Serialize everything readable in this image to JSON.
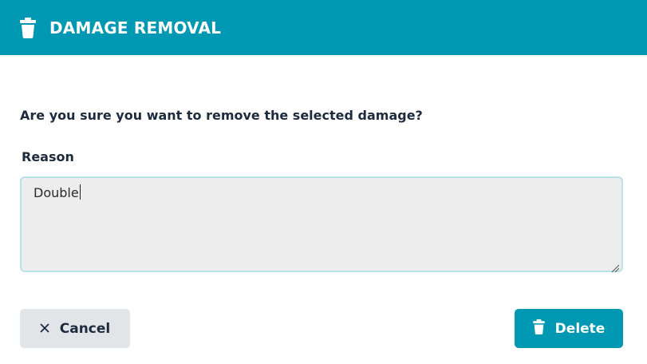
{
  "header": {
    "title": "DAMAGE REMOVAL",
    "icon": "trash-icon",
    "background_color": "#0098b3"
  },
  "body": {
    "question": "Are you sure you want to remove the selected damage?",
    "reason_label": "Reason",
    "reason_value": "Double"
  },
  "footer": {
    "cancel_label": "Cancel",
    "cancel_icon": "close-icon",
    "delete_label": "Delete",
    "delete_icon": "trash-icon"
  }
}
